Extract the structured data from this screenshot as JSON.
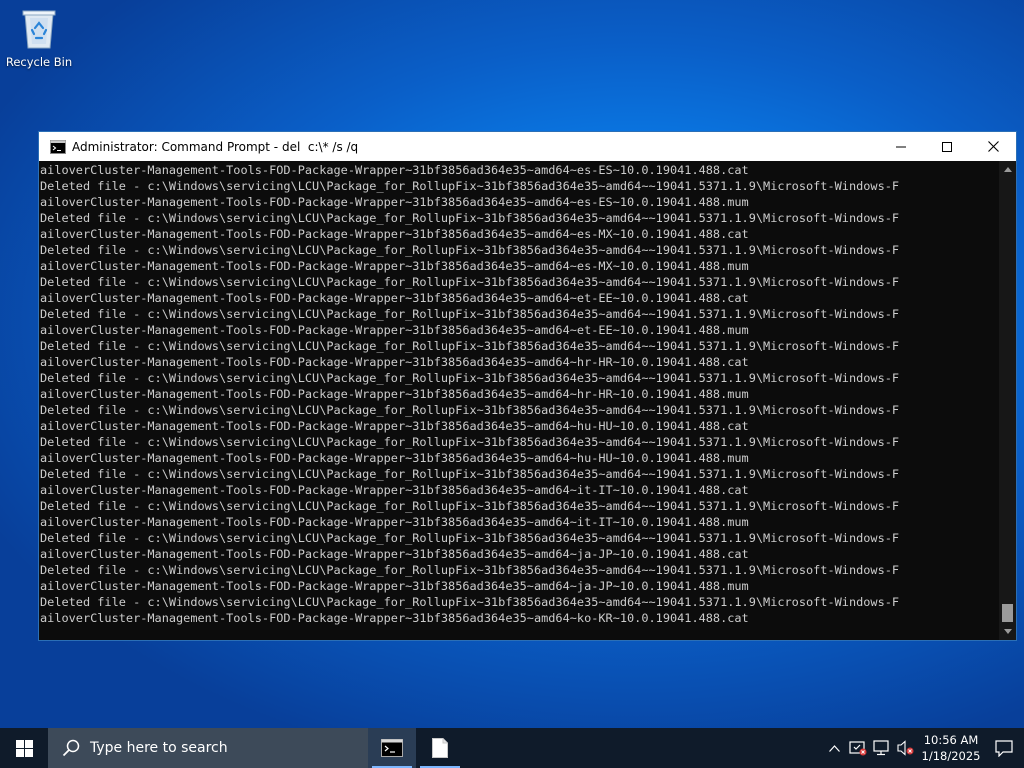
{
  "desktop": {
    "icons": [
      {
        "label": "Recycle Bin",
        "icon": "recycle-bin-icon"
      }
    ]
  },
  "window": {
    "title": "Administrator: Command Prompt - del  c:\\* /s /q",
    "icon": "cmd-icon",
    "controls": {
      "minimize": "minimize-icon",
      "maximize": "maximize-icon",
      "close": "close-icon"
    }
  },
  "console": {
    "lines": [
      "ailoverCluster-Management-Tools-FOD-Package-Wrapper~31bf3856ad364e35~amd64~es-ES~10.0.19041.488.cat",
      "Deleted file - c:\\Windows\\servicing\\LCU\\Package_for_RollupFix~31bf3856ad364e35~amd64~~19041.5371.1.9\\Microsoft-Windows-F",
      "ailoverCluster-Management-Tools-FOD-Package-Wrapper~31bf3856ad364e35~amd64~es-ES~10.0.19041.488.mum",
      "Deleted file - c:\\Windows\\servicing\\LCU\\Package_for_RollupFix~31bf3856ad364e35~amd64~~19041.5371.1.9\\Microsoft-Windows-F",
      "ailoverCluster-Management-Tools-FOD-Package-Wrapper~31bf3856ad364e35~amd64~es-MX~10.0.19041.488.cat",
      "Deleted file - c:\\Windows\\servicing\\LCU\\Package_for_RollupFix~31bf3856ad364e35~amd64~~19041.5371.1.9\\Microsoft-Windows-F",
      "ailoverCluster-Management-Tools-FOD-Package-Wrapper~31bf3856ad364e35~amd64~es-MX~10.0.19041.488.mum",
      "Deleted file - c:\\Windows\\servicing\\LCU\\Package_for_RollupFix~31bf3856ad364e35~amd64~~19041.5371.1.9\\Microsoft-Windows-F",
      "ailoverCluster-Management-Tools-FOD-Package-Wrapper~31bf3856ad364e35~amd64~et-EE~10.0.19041.488.cat",
      "Deleted file - c:\\Windows\\servicing\\LCU\\Package_for_RollupFix~31bf3856ad364e35~amd64~~19041.5371.1.9\\Microsoft-Windows-F",
      "ailoverCluster-Management-Tools-FOD-Package-Wrapper~31bf3856ad364e35~amd64~et-EE~10.0.19041.488.mum",
      "Deleted file - c:\\Windows\\servicing\\LCU\\Package_for_RollupFix~31bf3856ad364e35~amd64~~19041.5371.1.9\\Microsoft-Windows-F",
      "ailoverCluster-Management-Tools-FOD-Package-Wrapper~31bf3856ad364e35~amd64~hr-HR~10.0.19041.488.cat",
      "Deleted file - c:\\Windows\\servicing\\LCU\\Package_for_RollupFix~31bf3856ad364e35~amd64~~19041.5371.1.9\\Microsoft-Windows-F",
      "ailoverCluster-Management-Tools-FOD-Package-Wrapper~31bf3856ad364e35~amd64~hr-HR~10.0.19041.488.mum",
      "Deleted file - c:\\Windows\\servicing\\LCU\\Package_for_RollupFix~31bf3856ad364e35~amd64~~19041.5371.1.9\\Microsoft-Windows-F",
      "ailoverCluster-Management-Tools-FOD-Package-Wrapper~31bf3856ad364e35~amd64~hu-HU~10.0.19041.488.cat",
      "Deleted file - c:\\Windows\\servicing\\LCU\\Package_for_RollupFix~31bf3856ad364e35~amd64~~19041.5371.1.9\\Microsoft-Windows-F",
      "ailoverCluster-Management-Tools-FOD-Package-Wrapper~31bf3856ad364e35~amd64~hu-HU~10.0.19041.488.mum",
      "Deleted file - c:\\Windows\\servicing\\LCU\\Package_for_RollupFix~31bf3856ad364e35~amd64~~19041.5371.1.9\\Microsoft-Windows-F",
      "ailoverCluster-Management-Tools-FOD-Package-Wrapper~31bf3856ad364e35~amd64~it-IT~10.0.19041.488.cat",
      "Deleted file - c:\\Windows\\servicing\\LCU\\Package_for_RollupFix~31bf3856ad364e35~amd64~~19041.5371.1.9\\Microsoft-Windows-F",
      "ailoverCluster-Management-Tools-FOD-Package-Wrapper~31bf3856ad364e35~amd64~it-IT~10.0.19041.488.mum",
      "Deleted file - c:\\Windows\\servicing\\LCU\\Package_for_RollupFix~31bf3856ad364e35~amd64~~19041.5371.1.9\\Microsoft-Windows-F",
      "ailoverCluster-Management-Tools-FOD-Package-Wrapper~31bf3856ad364e35~amd64~ja-JP~10.0.19041.488.cat",
      "Deleted file - c:\\Windows\\servicing\\LCU\\Package_for_RollupFix~31bf3856ad364e35~amd64~~19041.5371.1.9\\Microsoft-Windows-F",
      "ailoverCluster-Management-Tools-FOD-Package-Wrapper~31bf3856ad364e35~amd64~ja-JP~10.0.19041.488.mum",
      "Deleted file - c:\\Windows\\servicing\\LCU\\Package_for_RollupFix~31bf3856ad364e35~amd64~~19041.5371.1.9\\Microsoft-Windows-F",
      "ailoverCluster-Management-Tools-FOD-Package-Wrapper~31bf3856ad364e35~amd64~ko-KR~10.0.19041.488.cat"
    ],
    "scroll_position": 0.97
  },
  "taskbar": {
    "start_icon": "windows-logo-icon",
    "search_placeholder": "Type here to search",
    "pinned": [
      {
        "name": "command-prompt",
        "icon": "cmd-icon",
        "active": true
      },
      {
        "name": "document",
        "icon": "file-icon",
        "active": false
      }
    ],
    "tray_icons": [
      "chevron-up-icon",
      "security-warning-icon",
      "network-icon",
      "volume-muted-icon"
    ],
    "clock": {
      "time": "10:56 AM",
      "date": "1/18/2025"
    },
    "notification_icon": "notification-icon"
  },
  "colors": {
    "console_bg": "#0c0c0c",
    "console_text": "#cccccc",
    "taskbar_bg": "#0f1b2a",
    "search_bg": "#3d4a59",
    "desktop_blue": "#0a7ae6"
  }
}
